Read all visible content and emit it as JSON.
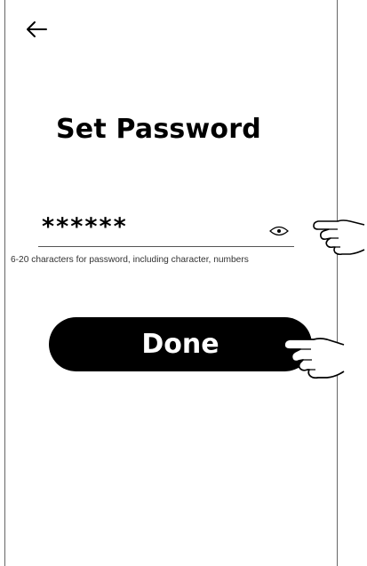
{
  "nav": {
    "back_icon": "arrow-left-icon"
  },
  "header": {
    "title": "Set Password"
  },
  "password": {
    "value": "******",
    "toggle_icon": "eye-icon",
    "hint": "6-20 characters for password, including character, numbers"
  },
  "actions": {
    "done_label": "Done"
  },
  "illustration": {
    "pointer_icon": "pointing-hand-icon"
  },
  "colors": {
    "button_bg": "#000000",
    "button_text": "#ffffff",
    "background": "#ffffff"
  }
}
